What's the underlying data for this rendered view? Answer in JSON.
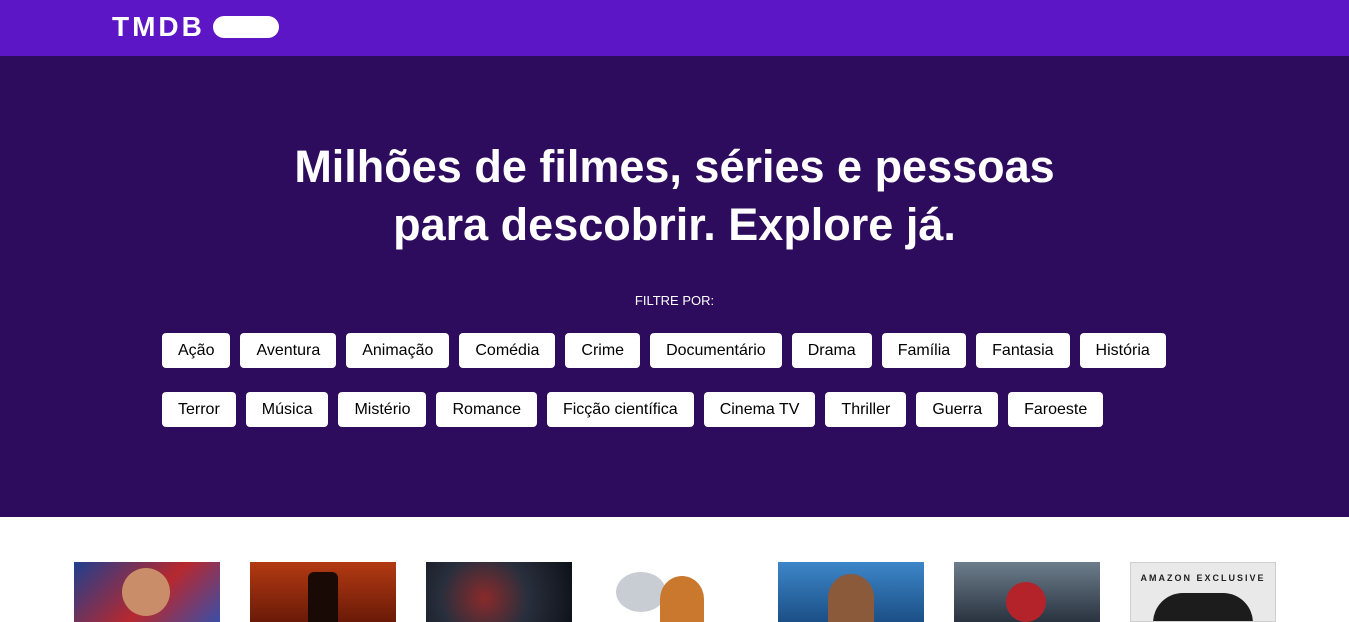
{
  "header": {
    "logo_text": "TMDB"
  },
  "hero": {
    "title_line1": "Milhões de filmes, séries e pessoas",
    "title_line2": "para descobrir. Explore já.",
    "filter_label": "FILTRE POR:"
  },
  "genres_row1": [
    "Ação",
    "Aventura",
    "Animação",
    "Comédia",
    "Crime",
    "Documentário",
    "Drama",
    "Família",
    "Fantasia",
    "História"
  ],
  "genres_row2": [
    "Terror",
    "Música",
    "Mistério",
    "Romance",
    "Ficção científica",
    "Cinema TV",
    "Thriller",
    "Guerra",
    "Faroeste"
  ],
  "posters": {
    "p7_label": "AMAZON EXCLUSIVE"
  },
  "colors": {
    "topbar": "#5c16c5",
    "hero": "#2d0c5e",
    "chip": "#ffffff"
  }
}
